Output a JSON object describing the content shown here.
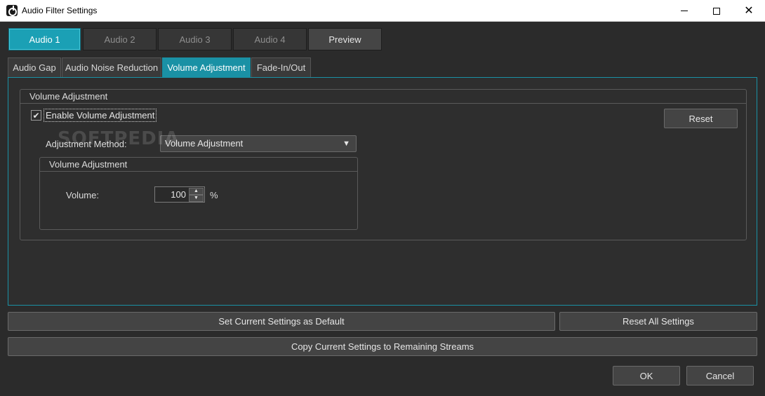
{
  "window": {
    "title": "Audio Filter Settings",
    "minimize_icon": "minimize-icon",
    "maximize_icon": "maximize-icon",
    "close_icon": "close-icon"
  },
  "stream_tabs": [
    {
      "label": "Audio 1",
      "active": true
    },
    {
      "label": "Audio 2",
      "active": false
    },
    {
      "label": "Audio 3",
      "active": false
    },
    {
      "label": "Audio 4",
      "active": false
    }
  ],
  "preview_label": "Preview",
  "sub_tabs": [
    {
      "label": "Audio Gap",
      "active": false
    },
    {
      "label": "Audio Noise Reduction",
      "active": false
    },
    {
      "label": "Volume Adjustment",
      "active": true
    },
    {
      "label": "Fade-In/Out",
      "active": false
    }
  ],
  "volume_adjustment": {
    "group_title": "Volume Adjustment",
    "enable_label": "Enable Volume Adjustment",
    "enable_checked": true,
    "reset_label": "Reset",
    "method_label": "Adjustment Method:",
    "method_value": "Volume Adjustment",
    "inner_group_title": "Volume Adjustment",
    "volume_label": "Volume:",
    "volume_value": "100",
    "volume_unit": "%"
  },
  "watermark": "SOFTPEDIA",
  "footer": {
    "set_default_label": "Set Current Settings as Default",
    "reset_all_label": "Reset All Settings",
    "copy_label": "Copy Current Settings to Remaining Streams",
    "ok_label": "OK",
    "cancel_label": "Cancel"
  },
  "colors": {
    "accent": "#1ba0b5",
    "background": "#2b2b2b"
  }
}
